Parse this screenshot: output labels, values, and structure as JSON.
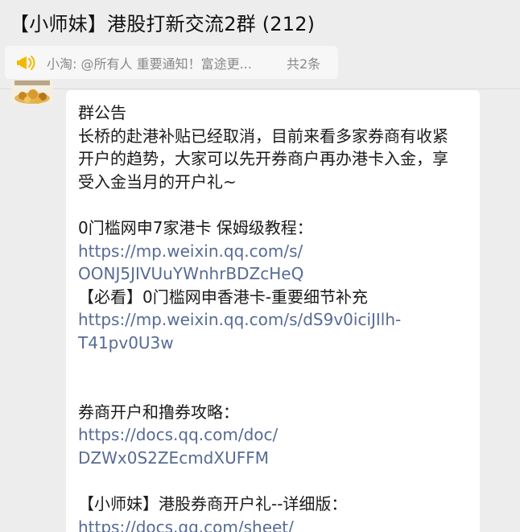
{
  "header": {
    "title": "【小师妹】港股打新交流2群 (212)"
  },
  "pinned_notice": {
    "icon": "megaphone-icon",
    "text": "小淘: @所有人 重要通知！富途更...",
    "count": "共2条"
  },
  "message": {
    "avatar_icon": "sender-avatar",
    "lines": [
      "群公告",
      "长桥的赴港补贴已经取消，目前来看多家券商有收紧",
      "开户的趋势，大家可以先开券商户再办港卡入金，享",
      "受入金当月的开户礼~",
      "",
      "0门槛网申7家港卡 保姆级教程：",
      "https://mp.weixin.qq.com/s/",
      "OONJ5JIVUuYWnhrBDZcHeQ",
      "【必看】0门槛网申香港卡-重要细节补充",
      "https://mp.weixin.qq.com/s/dS9v0iciJIlh-",
      "T41pv0U3w",
      "",
      "",
      "券商开户和撸券攻略：",
      "https://docs.qq.com/doc/",
      "DZWx0S2ZEcmdXUFFM",
      "",
      "【小师妹】港股券商开户礼--详细版：",
      "https://docs.qq.com/sheet/"
    ]
  },
  "colors": {
    "link": "#576b95",
    "text": "#1a1a1a",
    "background": "#ededed",
    "bubble": "#ffffff",
    "notice_icon": "#f5b800"
  }
}
